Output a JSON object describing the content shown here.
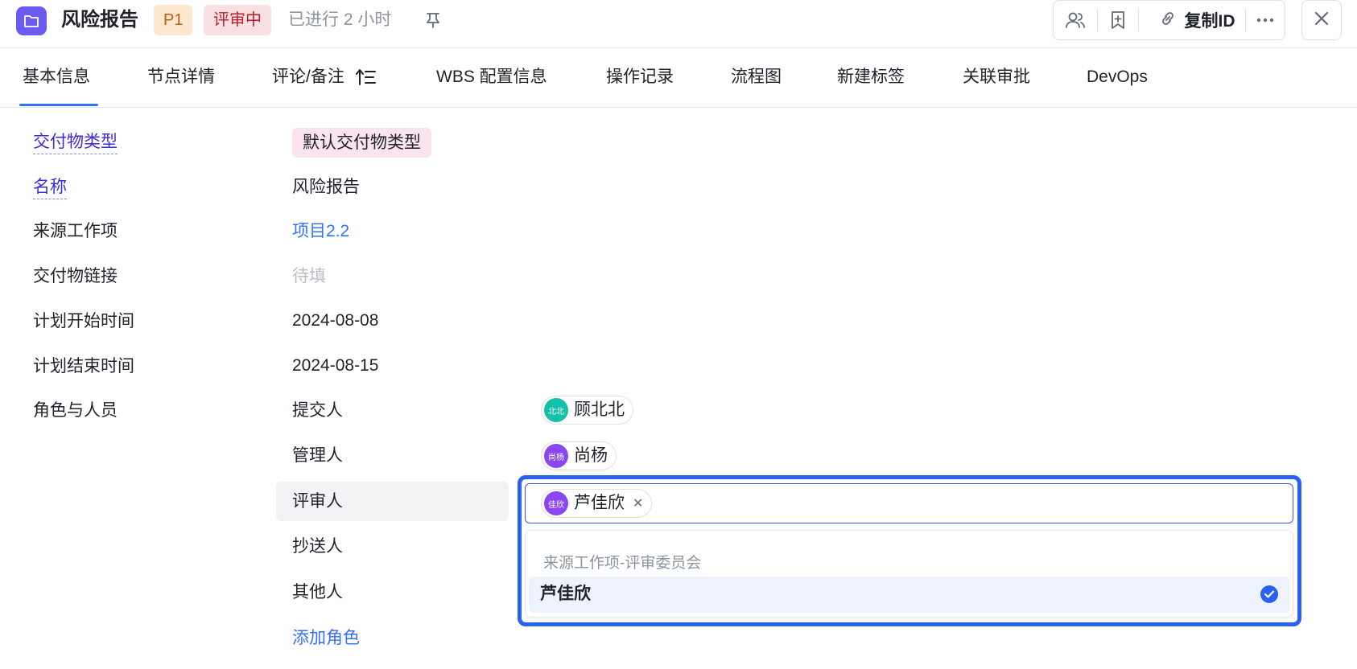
{
  "header": {
    "title": "风险报告",
    "priority": "P1",
    "status": "评审中",
    "elapsed": "已进行 2 小时",
    "copy_id_label": "复制ID",
    "colors": {
      "app_icon": "#6b5bf0",
      "priority_bg": "#fde7cf",
      "status_bg": "#fbe0e3"
    }
  },
  "tabs": [
    {
      "label": "基本信息"
    },
    {
      "label": "节点详情"
    },
    {
      "label": "评论/备注"
    },
    {
      "label": "WBS 配置信息"
    },
    {
      "label": "操作记录"
    },
    {
      "label": "流程图"
    },
    {
      "label": "新建标签"
    },
    {
      "label": "关联审批"
    },
    {
      "label": "DevOps"
    }
  ],
  "form": {
    "deliverable_type": {
      "label": "交付物类型",
      "value": "默认交付物类型"
    },
    "name": {
      "label": "名称",
      "value": "风险报告"
    },
    "source_item": {
      "label": "来源工作项",
      "value": "项目2.2"
    },
    "deliverable_link": {
      "label": "交付物链接",
      "value": "待填"
    },
    "plan_start": {
      "label": "计划开始时间",
      "value": "2024-08-08"
    },
    "plan_end": {
      "label": "计划结束时间",
      "value": "2024-08-15"
    },
    "roles_label": "角色与人员",
    "roles": [
      {
        "role": "提交人",
        "person": {
          "name": "顾北北",
          "avatar_text": "北北",
          "color": "#14c0a8"
        }
      },
      {
        "role": "管理人",
        "person": {
          "name": "尚杨",
          "avatar_text": "尚杨",
          "color": "#8a46f0"
        }
      },
      {
        "role": "评审人",
        "person": {
          "name": "芦佳欣",
          "avatar_text": "佳欣",
          "color": "#8a46f0"
        }
      },
      {
        "role": "抄送人"
      },
      {
        "role": "其他人"
      }
    ],
    "add_role": "添加角色"
  },
  "selector": {
    "group_title": "来源工作项-评审委员会",
    "options": [
      {
        "label": "芦佳欣",
        "selected": true
      }
    ],
    "accent": "#2a61f5"
  }
}
